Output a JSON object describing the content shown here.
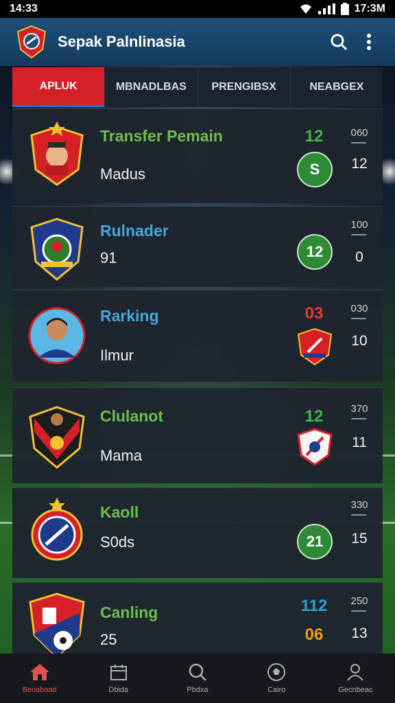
{
  "status_bar": {
    "time_left": "14:33",
    "time_right": "17:3M"
  },
  "app_bar": {
    "title": "Sepak Palnlinasia",
    "logo_icon": "club-crest-icon",
    "search_icon": "search-icon",
    "menu_icon": "more-vert-icon"
  },
  "tabs": [
    {
      "label": "APLUK",
      "active": true
    },
    {
      "label": "MBNADLBAS",
      "active": false
    },
    {
      "label": "PRENGIBSX",
      "active": false
    },
    {
      "label": "NEABGEX",
      "active": false
    }
  ],
  "cards": [
    {
      "title": "Transfer Pemain",
      "title_color": "#6cc04a",
      "subtitle": "Madus",
      "score_top": "12",
      "score_top_color": "#43b649",
      "pill": "S",
      "right_small": "060",
      "right_big": "12"
    },
    {
      "title": "Rulnader",
      "title_color": "#3fa9dc",
      "subtitle": "91",
      "score_top": "",
      "pill": "12",
      "right_small": "100",
      "right_big": "0"
    },
    {
      "title": "Rarking",
      "title_color": "#3fa9dc",
      "subtitle": "Ilmur",
      "score_top": "03",
      "score_top_color": "#e53935",
      "pill": "",
      "right_small": "030",
      "right_big": "10"
    },
    {
      "title": "Clulanot",
      "title_color": "#6cc04a",
      "subtitle": "Mama",
      "score_top": "12",
      "score_top_color": "#43b649",
      "pill": "",
      "right_small": "370",
      "right_big": "11"
    },
    {
      "title": "Kaoll",
      "title_color": "#6cc04a",
      "subtitle": "S0ds",
      "score_top": "",
      "pill": "21",
      "right_small": "330",
      "right_big": "15"
    },
    {
      "title": "Canling",
      "title_color": "#6cc04a",
      "subtitle": "25",
      "score_top": "112",
      "score_top_color": "#2f9fd8",
      "score_second": "06",
      "score_second_color": "#f39c12",
      "pill": "",
      "right_small": "250",
      "right_big": "13"
    }
  ],
  "bottom_nav": [
    {
      "label": "Beoabaad",
      "icon": "home-icon",
      "active": true
    },
    {
      "label": "Dbida",
      "icon": "calendar-icon",
      "active": false
    },
    {
      "label": "Pbdxa",
      "icon": "search-icon",
      "active": false
    },
    {
      "label": "Cairo",
      "icon": "ball-icon",
      "active": false
    },
    {
      "label": "Gecnbeac",
      "icon": "profile-icon",
      "active": false
    }
  ]
}
